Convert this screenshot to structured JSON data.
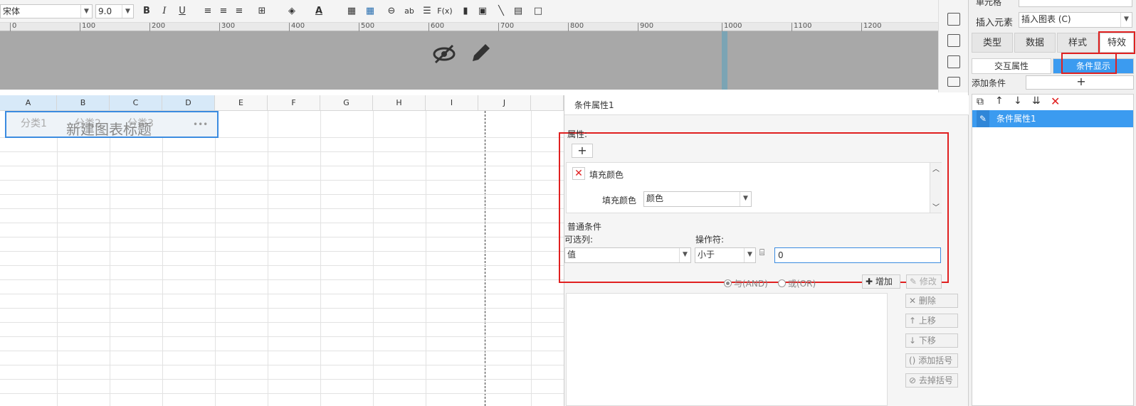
{
  "toolbar": {
    "font_name": "宋体",
    "font_size": "9.0",
    "bold": "B",
    "italic": "I",
    "underline": "U",
    "fx_label": "F(x)",
    "ab_label": "ab"
  },
  "ruler": {
    "ticks": [
      "0",
      "100",
      "200",
      "300",
      "400",
      "500",
      "600",
      "700",
      "800",
      "900",
      "1000",
      "1100",
      "1200"
    ]
  },
  "sheet": {
    "columns": [
      "A",
      "B",
      "C",
      "D",
      "E",
      "F",
      "G",
      "H",
      "I",
      "J"
    ],
    "chart_title": "新建图表标题",
    "categories": [
      "分类1",
      "分类2",
      "分类3"
    ],
    "more": "•••"
  },
  "props": {
    "top_label": "单元格",
    "insert_label": "插入元素",
    "insert_value": "插入图表 (C)",
    "tabs": [
      "类型",
      "数据",
      "样式",
      "特效"
    ],
    "subtabs": [
      "交互属性",
      "条件显示"
    ],
    "add_condition_label": "添加条件",
    "add_icon": "+",
    "list_item": "条件属性1"
  },
  "dialog": {
    "title": "条件属性1",
    "attr_section": "属性:",
    "fill_color_row": "填充颜色",
    "fill_color_label": "填充颜色",
    "fill_color_value": "颜色",
    "normal_condition": "普通条件",
    "selectable_col_label": "可选列:",
    "selectable_col_value": "值",
    "operator_label": "操作符:",
    "operator_value": "小于",
    "value_input": "0",
    "and_label": "与(AND)",
    "or_label": "或(OR)",
    "add_btn": "增加",
    "modify_btn": "修改",
    "delete_btn": "删除",
    "up_btn": "上移",
    "down_btn": "下移",
    "add_bracket_btn": "添加括号",
    "remove_bracket_btn": "去掉括号"
  }
}
